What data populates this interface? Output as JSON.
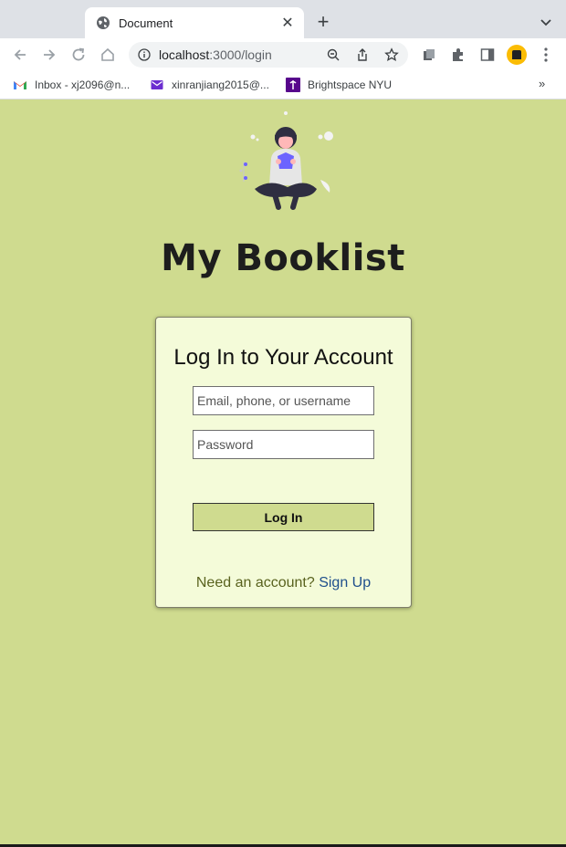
{
  "browser": {
    "tab_title": "Document",
    "new_tab_symbol": "+",
    "close_symbol": "✕",
    "url_host": "localhost",
    "url_path": ":3000/login",
    "bookmarks": [
      {
        "label": "Inbox - xj2096@n...",
        "icon": "gmail-icon"
      },
      {
        "label": "xinranjiang2015@...",
        "icon": "mail-icon"
      },
      {
        "label": "Brightspace NYU",
        "icon": "brightspace-icon"
      }
    ],
    "bookmarks_more": "»"
  },
  "page": {
    "brand": "My Booklist",
    "login_card": {
      "title": "Log In to Your Account",
      "username_placeholder": "Email, phone, or username",
      "password_placeholder": "Password",
      "submit_label": "Log In",
      "signup_prompt": "Need an account?",
      "signup_link": "Sign Up"
    }
  },
  "colors": {
    "page_background": "#cfdb8f",
    "card_background": "#f4fbd9",
    "link": "#1f4f8c"
  }
}
